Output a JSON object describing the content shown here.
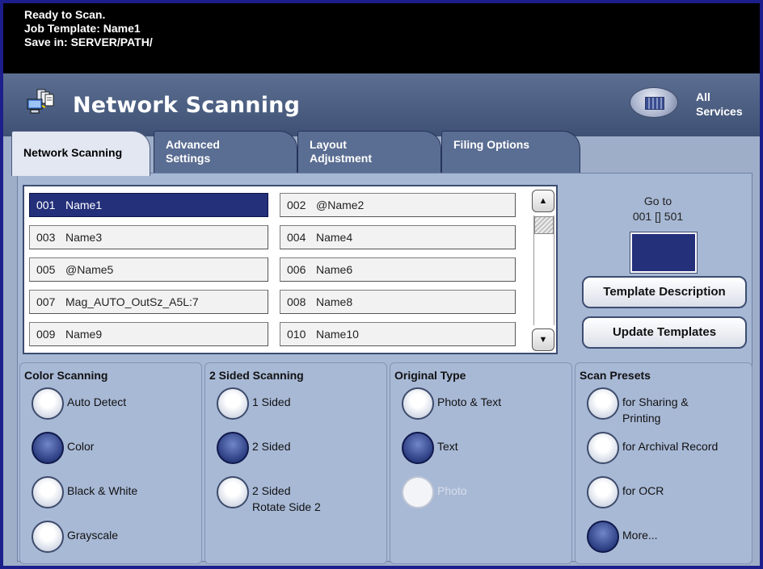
{
  "status": {
    "line1": "Ready to Scan.",
    "line2": "Job Template: Name1",
    "line3": "Save in: SERVER/PATH/"
  },
  "header": {
    "title": "Network Scanning",
    "all_services": [
      "All",
      "Services"
    ]
  },
  "tabs": [
    {
      "label": [
        "Network Scanning"
      ]
    },
    {
      "label": [
        "Advanced",
        "Settings"
      ]
    },
    {
      "label": [
        "Layout",
        "Adjustment"
      ]
    },
    {
      "label": [
        "Filing Options"
      ]
    }
  ],
  "templates": [
    {
      "num": "001",
      "name": "Name1"
    },
    {
      "num": "002",
      "name": "@Name2"
    },
    {
      "num": "003",
      "name": "Name3"
    },
    {
      "num": "004",
      "name": "Name4"
    },
    {
      "num": "005",
      "name": "@Name5"
    },
    {
      "num": "006",
      "name": "Name6"
    },
    {
      "num": "007",
      "name": "Mag_AUTO_OutSz_A5L:7"
    },
    {
      "num": "008",
      "name": "Name8"
    },
    {
      "num": "009",
      "name": "Name9"
    },
    {
      "num": "010",
      "name": "Name10"
    }
  ],
  "scroll": {
    "up": "▲",
    "down": "▼"
  },
  "goto": {
    "label": "Go to",
    "range": "001 [] 501"
  },
  "buttons": {
    "template_description": "Template Description",
    "update_templates": "Update Templates"
  },
  "color_scanning": {
    "title": "Color Scanning",
    "options": [
      "Auto Detect",
      "Color",
      "Black & White",
      "Grayscale"
    ],
    "selected": "Color"
  },
  "two_sided": {
    "title": "2 Sided Scanning",
    "options": [
      "1 Sided",
      "2 Sided",
      "2 Sided Rotate Side 2"
    ],
    "option3_lines": [
      "2 Sided",
      "Rotate Side 2"
    ],
    "selected": "2 Sided"
  },
  "original_type": {
    "title": "Original Type",
    "options": [
      "Photo & Text",
      "Text",
      "Photo"
    ],
    "selected": "Text",
    "disabled": "Photo"
  },
  "scan_presets": {
    "title": "Scan Presets",
    "options": [
      "for Sharing & Printing",
      "for Archival Record",
      "for OCR",
      "More..."
    ],
    "option1_lines": [
      "for Sharing &",
      "Printing"
    ],
    "selected": "More..."
  },
  "colors": {
    "selected": "#24307a",
    "header": "#4a5d82",
    "border": "#1c1e8c"
  }
}
